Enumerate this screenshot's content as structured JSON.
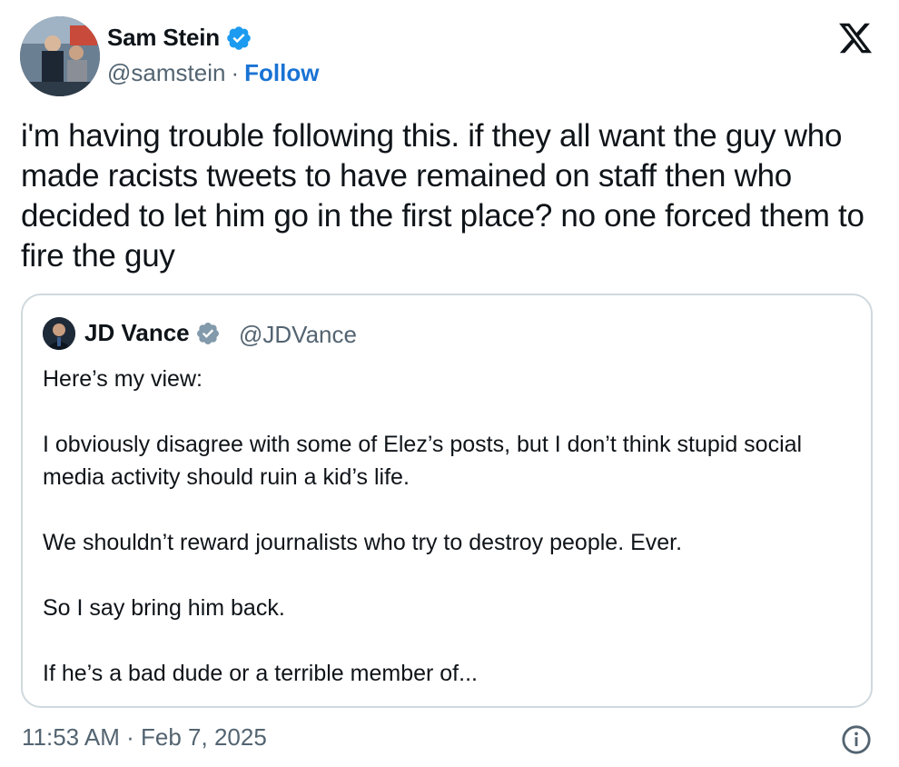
{
  "tweet": {
    "author_name": "Sam Stein",
    "handle": "@samstein",
    "separator": "·",
    "follow_label": "Follow",
    "text": "i'm having trouble following this. if they all want the guy who made racists tweets to have remained on staff then who decided to let him go in the first place? no one forced them to fire the guy",
    "timestamp": "11:53 AM · Feb 7, 2025"
  },
  "quoted": {
    "author_name": "JD Vance",
    "handle": "@JDVance",
    "paragraphs": [
      "Here’s my view:",
      "I obviously disagree with some of Elez’s posts, but I don’t think stupid social media activity should ruin a kid’s life.",
      "We shouldn’t reward journalists who try to destroy people. Ever.",
      "So I say bring him back.",
      "If he’s a bad dude or a terrible member of..."
    ]
  },
  "icons": {
    "verified": "verified-badge-icon",
    "brand": "x-logo-icon",
    "info": "info-icon"
  },
  "colors": {
    "link": "#1a73d4",
    "verified": "#1d9bf0",
    "muted": "#536471",
    "border": "#cfd9de",
    "text": "#0f1419"
  }
}
